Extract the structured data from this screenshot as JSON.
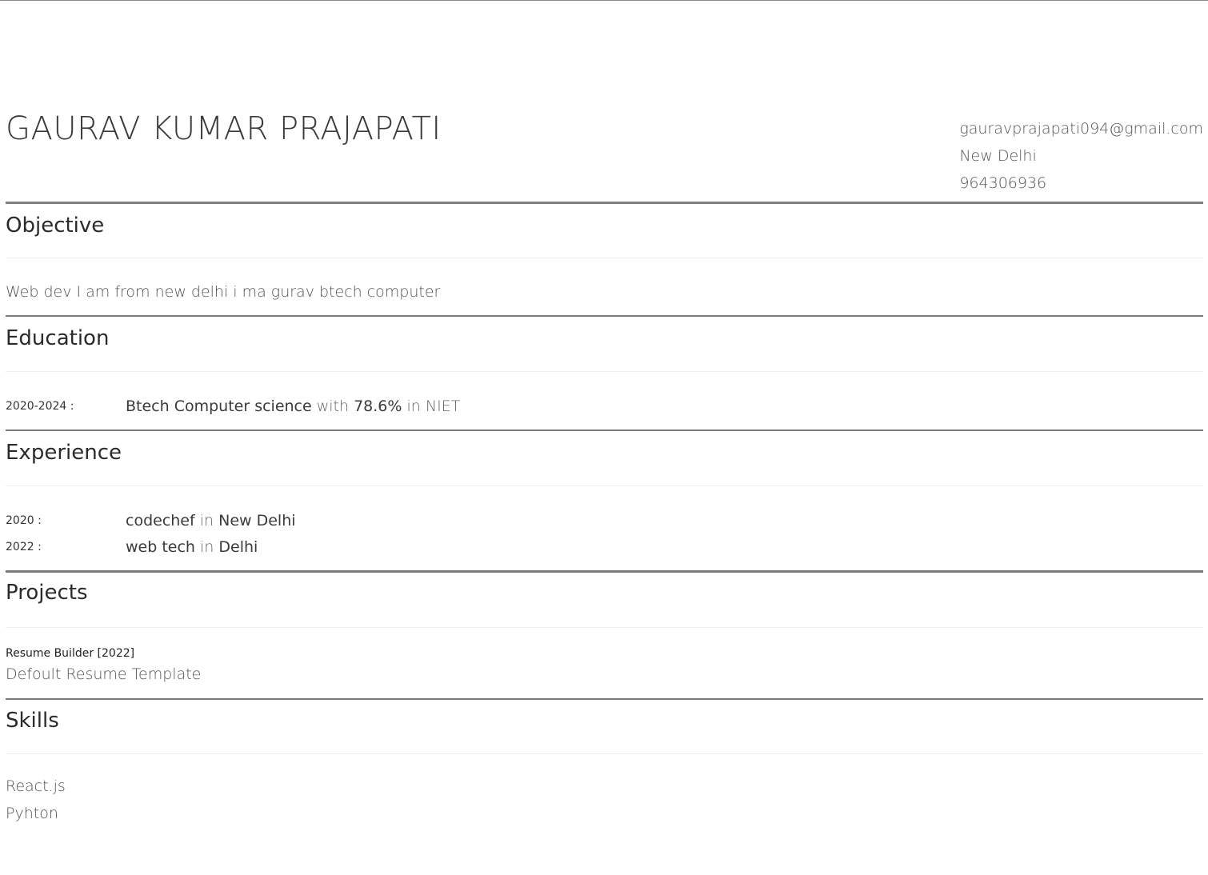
{
  "header": {
    "name": "GAURAV KUMAR PRAJAPATI",
    "email": "gauravprajapati094@gmail.com",
    "location": "New Delhi",
    "phone": "964306936"
  },
  "objective": {
    "title": "Objective",
    "text": "Web dev I am from new delhi i ma gurav btech computer"
  },
  "education": {
    "title": "Education",
    "items": [
      {
        "date": "2020-2024 :",
        "degree": "Btech Computer science",
        "with": "with",
        "score": "78.6%",
        "in": "in",
        "institute": "NIET"
      }
    ]
  },
  "experience": {
    "title": "Experience",
    "items": [
      {
        "date": "2020 :",
        "company": "codechef",
        "in": "in",
        "place": "New Delhi"
      },
      {
        "date": "2022 :",
        "company": "web tech",
        "in": "in",
        "place": "Delhi"
      }
    ]
  },
  "projects": {
    "title": "Projects",
    "items": [
      {
        "name": "Resume Builder [2022]",
        "description": "Defoult Resume Template"
      }
    ]
  },
  "skills": {
    "title": "Skills",
    "items": [
      "React.js",
      "Pyhton"
    ]
  }
}
